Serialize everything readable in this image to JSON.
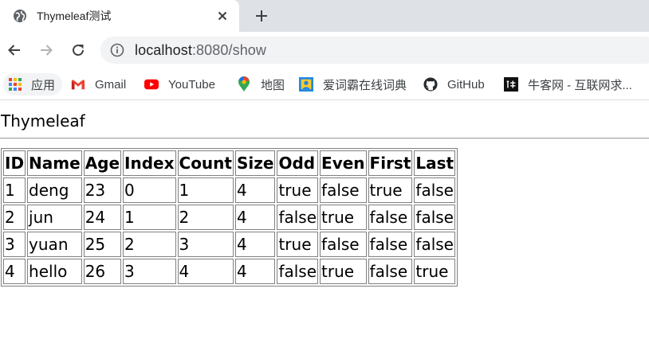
{
  "browser": {
    "tab": {
      "title": "Thymeleaf测试",
      "favicon": "globe-icon"
    },
    "toolbar": {
      "url_host": "localhost",
      "url_rest": ":8080/show"
    },
    "bookmarks": [
      {
        "label": "应用",
        "icon": "apps-grid-icon"
      },
      {
        "label": "Gmail",
        "icon": "gmail-icon"
      },
      {
        "label": "YouTube",
        "icon": "youtube-icon"
      },
      {
        "label": "地图",
        "icon": "maps-pin-icon"
      },
      {
        "label": "爱词霸在线词典",
        "icon": "iciba-icon"
      },
      {
        "label": "GitHub",
        "icon": "github-icon"
      },
      {
        "label": "牛客网 - 互联网求...",
        "icon": "nowcoder-icon"
      }
    ]
  },
  "page": {
    "heading": "Thymeleaf",
    "table": {
      "headers": [
        "ID",
        "Name",
        "Age",
        "Index",
        "Count",
        "Size",
        "Odd",
        "Even",
        "First",
        "Last"
      ],
      "rows": [
        [
          "1",
          "deng",
          "23",
          "0",
          "1",
          "4",
          "true",
          "false",
          "true",
          "false"
        ],
        [
          "2",
          "jun",
          "24",
          "1",
          "2",
          "4",
          "false",
          "true",
          "false",
          "false"
        ],
        [
          "3",
          "yuan",
          "25",
          "2",
          "3",
          "4",
          "true",
          "false",
          "false",
          "false"
        ],
        [
          "4",
          "hello",
          "26",
          "3",
          "4",
          "4",
          "false",
          "true",
          "false",
          "true"
        ]
      ]
    }
  },
  "colors": {
    "tabstrip_bg": "#dee1e6",
    "omnibox_bg": "#f1f3f4",
    "youtube_red": "#ff0000"
  }
}
